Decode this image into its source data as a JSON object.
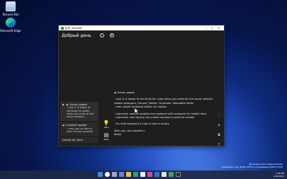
{
  "desktop": {
    "icons": [
      {
        "label": "Recycle Bin",
        "icon": "recycle-bin-icon"
      },
      {
        "label": "Microsoft Edge",
        "icon": "edge-icon"
      }
    ]
  },
  "window": {
    "title": "Just_answer",
    "controls": [
      "–",
      "□",
      "✕"
    ]
  },
  "appbar": {
    "greeting": "Добрый день",
    "icons": [
      "info-icon",
      "settings-icon"
    ]
  },
  "notes": [
    {
      "title": "Social update",
      "preview": "- new: it is easier to set limits for notes when you write for the social network...",
      "selected": true
    },
    {
      "title": "Snowfall update",
      "preview": "- new: pop up idea or note if it was updated",
      "selected": false
    },
    {
      "title": "Games for jame",
      "preview": "",
      "selected": false
    }
  ],
  "side_actions": [
    {
      "icon": "lightbulb-icon",
      "label": "Idea"
    },
    {
      "icon": "note-icon",
      "label": "Note"
    }
  ],
  "editor": {
    "lines": [
      "Social update",
      "",
      "- new: it is easier to set limits for notes when you write for the social network.",
      "Added Instagram, Discord, Twitter, Facebook, VKontakte limits",
      "- new: closee keyboard button for mobile.",
      "",
      "- improved: special symbols line replaced with keyboard for mobile devs",
      "- improved: note layout has a wider window to write for mobile",
      "",
      "- fix: hide keyboard if note or idea is empty.",
      "",
      "Wish you nice weather:)",
      "Bobio"
    ]
  },
  "rail_icons": [
    "more-vert-icon",
    "chart-icon",
    "copy-icon",
    "help-icon"
  ],
  "taskbar": {
    "time": "2:08 PM",
    "date": "1/30/2022"
  },
  "watermark": {
    "line1": "Windows 11 Pro Insider Preview",
    "line2": "Evaluation copy. Build 22533.rs_prerelease.220107-1122"
  }
}
